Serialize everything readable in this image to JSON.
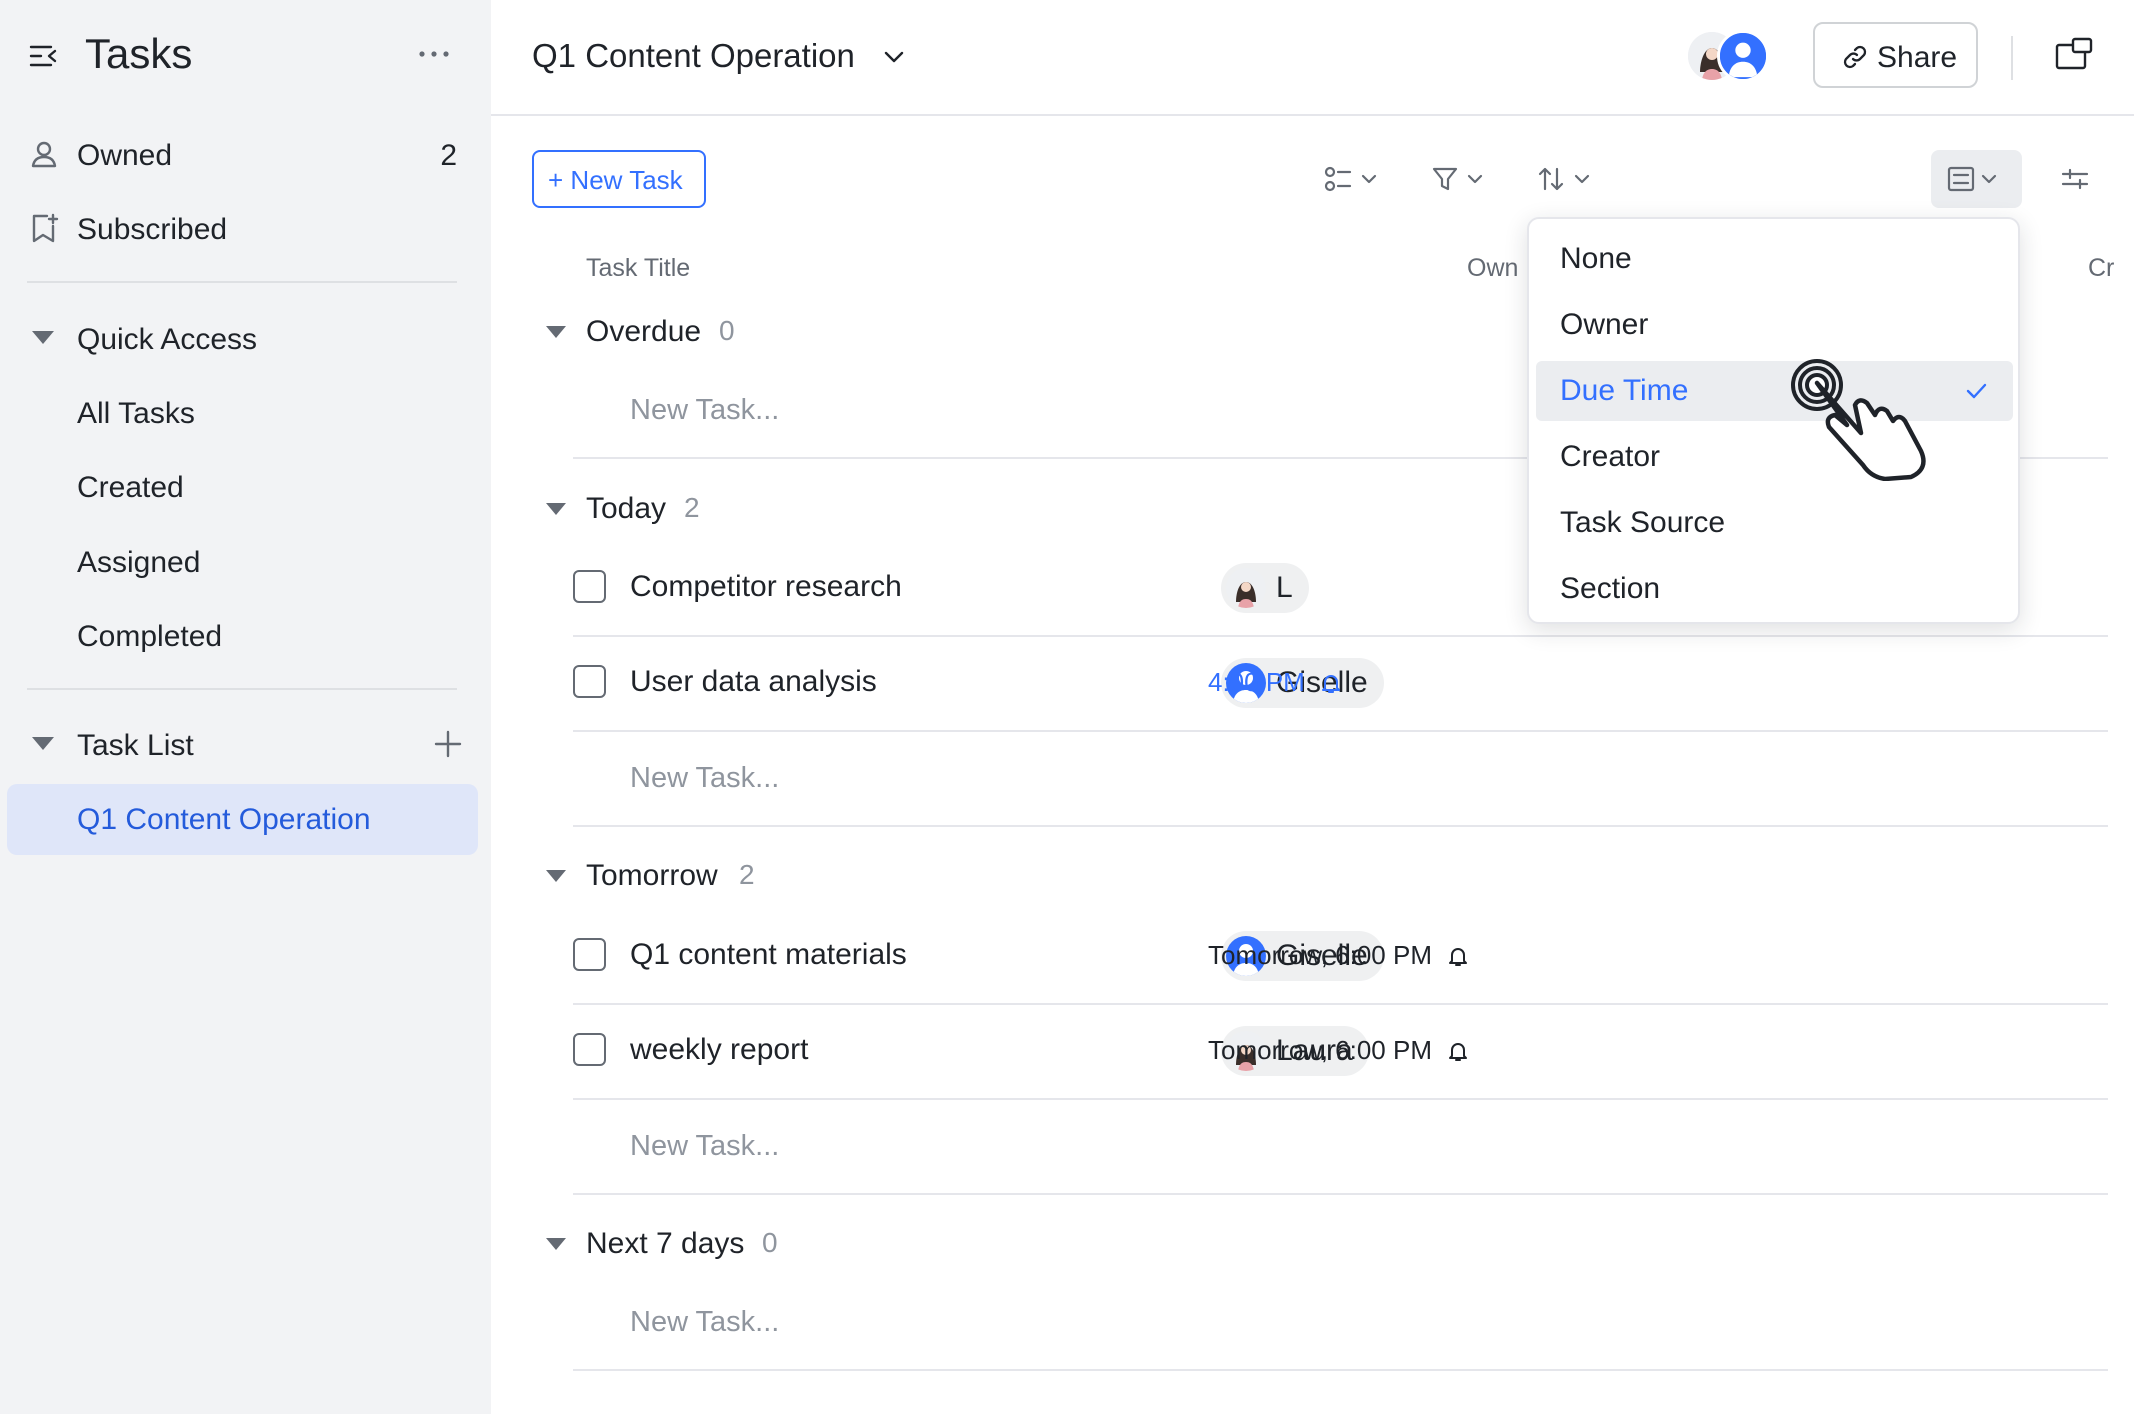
{
  "sidebar": {
    "title": "Tasks",
    "items": [
      {
        "label": "Owned",
        "count": "2"
      },
      {
        "label": "Subscribed"
      }
    ],
    "quick_access": {
      "label": "Quick Access",
      "items": [
        "All Tasks",
        "Created",
        "Assigned",
        "Completed"
      ]
    },
    "task_list": {
      "label": "Task List",
      "active": "Q1 Content Operation"
    }
  },
  "header": {
    "title": "Q1 Content Operation",
    "share_label": "Share"
  },
  "toolbar": {
    "new_task_label": "New Task"
  },
  "columns": {
    "task_title": "Task Title",
    "owner": "Own",
    "creator": "Cr"
  },
  "groups": [
    {
      "label": "Overdue",
      "count": "0"
    },
    {
      "label": "Today",
      "count": "2"
    },
    {
      "label": "Tomorrow",
      "count": "2"
    },
    {
      "label": "Next 7 days",
      "count": "0"
    }
  ],
  "tasks": {
    "today": [
      {
        "title": "Competitor research",
        "owner": "L"
      },
      {
        "title": "User data analysis",
        "owner": "Giselle",
        "due": "4:00 PM"
      }
    ],
    "tomorrow": [
      {
        "title": "Q1 content materials",
        "owner": "Giselle",
        "due": "Tomorrow, 6:00 PM"
      },
      {
        "title": "weekly report",
        "owner": "Laura",
        "due": "Tomorrow, 6:00 PM"
      }
    ]
  },
  "new_task_placeholder": "New Task...",
  "group_by_menu": {
    "options": [
      "None",
      "Owner",
      "Due Time",
      "Creator",
      "Task Source",
      "Section"
    ],
    "selected": "Due Time"
  },
  "colors": {
    "accent": "#3370ff",
    "sidebar_bg": "#f2f3f5",
    "active_item_bg": "#dfe6f9"
  }
}
